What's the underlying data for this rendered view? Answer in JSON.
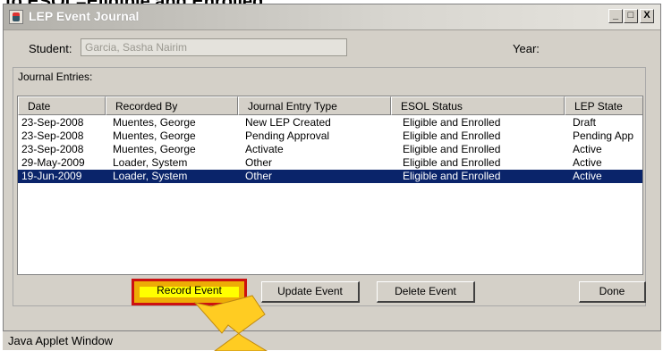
{
  "caption": "to ESOL=Eligible and Enrolled",
  "window": {
    "title": "LEP Event Journal",
    "controls": {
      "minimize": "_",
      "maximize": "□",
      "close": "X"
    }
  },
  "form": {
    "student_label": "Student:",
    "student_value": "Garcia, Sasha Nairim",
    "year_label": "Year:"
  },
  "journal": {
    "group_label": "Journal Entries:",
    "columns": [
      "Date",
      "Recorded By",
      "Journal Entry Type",
      "ESOL Status",
      "LEP State"
    ],
    "rows": [
      [
        "23-Sep-2008",
        "Muentes, George",
        "New LEP Created",
        "Eligible and Enrolled",
        "Draft"
      ],
      [
        "23-Sep-2008",
        "Muentes, George",
        "Pending Approval",
        "Eligible and Enrolled",
        "Pending App"
      ],
      [
        "23-Sep-2008",
        "Muentes, George",
        "Activate",
        "Eligible and Enrolled",
        "Active"
      ],
      [
        "29-May-2009",
        "Loader, System",
        "Other",
        "Eligible and Enrolled",
        "Active"
      ],
      [
        "19-Jun-2009",
        "Loader, System",
        "Other",
        "Eligible and Enrolled",
        "Active"
      ]
    ],
    "selected_row": 5
  },
  "buttons": {
    "record": "Record Event",
    "update": "Update Event",
    "delete": "Delete Event",
    "done": "Done"
  },
  "status_bar": "Java Applet Window",
  "colors": {
    "selection": "#0a246a",
    "highlight_fill": "#ffff00",
    "highlight_border": "#cc1111",
    "arrow_fill": "#ffcc22"
  }
}
